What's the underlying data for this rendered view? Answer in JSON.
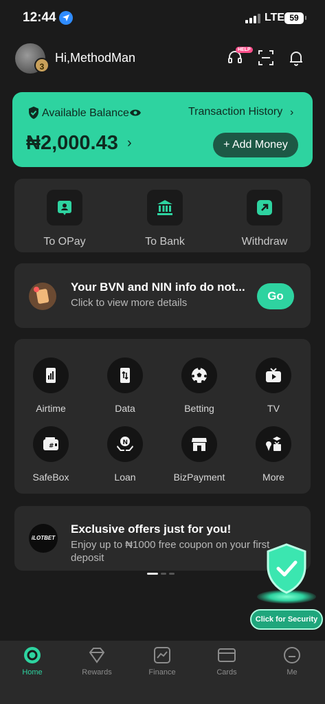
{
  "status_bar": {
    "time": "12:44",
    "network": "LTE",
    "battery": "59"
  },
  "header": {
    "greeting": "Hi,MethodMan",
    "avatar_level": "3",
    "help_badge": "HELP"
  },
  "balance": {
    "label": "Available Balance",
    "amount": "₦2,000.43",
    "history_label": "Transaction History",
    "add_money_label": "+ Add Money"
  },
  "transfers": [
    {
      "label": "To OPay",
      "icon": "person-card-icon"
    },
    {
      "label": "To Bank",
      "icon": "bank-icon"
    },
    {
      "label": "Withdraw",
      "icon": "withdraw-arrow-icon"
    }
  ],
  "notice": {
    "title": "Your BVN and NIN info do not...",
    "subtitle": "Click to view more details",
    "go_label": "Go"
  },
  "services": [
    {
      "label": "Airtime",
      "icon": "phone-icon"
    },
    {
      "label": "Data",
      "icon": "data-icon"
    },
    {
      "label": "Betting",
      "icon": "football-icon"
    },
    {
      "label": "TV",
      "icon": "tv-icon"
    },
    {
      "label": "SafeBox",
      "icon": "wallet-icon"
    },
    {
      "label": "Loan",
      "icon": "loan-hands-icon"
    },
    {
      "label": "BizPayment",
      "icon": "store-icon"
    },
    {
      "label": "More",
      "icon": "more-icon"
    }
  ],
  "promo": {
    "logo_text": "iLOTBET",
    "title": "Exclusive offers just for you!",
    "subtitle": "Enjoy up to ₦1000 free coupon on your first deposit"
  },
  "security": {
    "label": "Click for Security"
  },
  "bottom_nav": [
    {
      "label": "Home",
      "active": true
    },
    {
      "label": "Rewards",
      "active": false
    },
    {
      "label": "Finance",
      "active": false
    },
    {
      "label": "Cards",
      "active": false
    },
    {
      "label": "Me",
      "active": false
    }
  ],
  "colors": {
    "accent": "#2ed3a0",
    "background": "#1b1b1b",
    "panel": "#2a2a2a"
  }
}
